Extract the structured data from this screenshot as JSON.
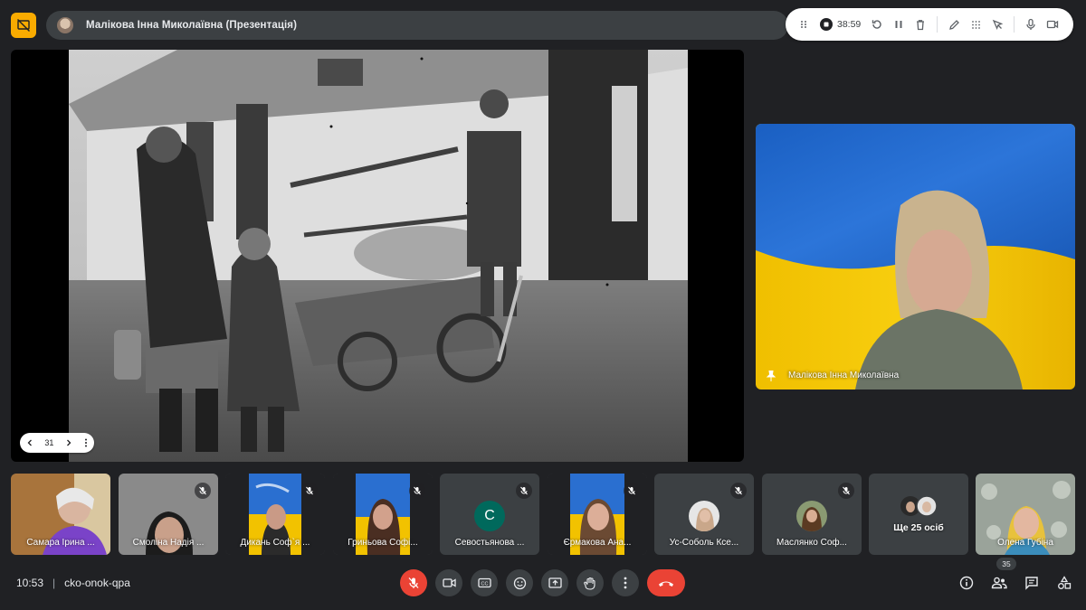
{
  "header": {
    "presenter_title": "Малікова Інна Миколаївна (Презентація)"
  },
  "recording_toolbar": {
    "timer": "38:59",
    "icons": [
      "drag-handle-icon",
      "record-stop-icon",
      "restart-icon",
      "pause-icon",
      "delete-icon",
      "pen-icon",
      "highlighter-icon",
      "pointer-icon",
      "mic-icon",
      "camera-icon"
    ]
  },
  "stage": {
    "slide_number": "31"
  },
  "speaker": {
    "name": "Малікова Інна Миколаївна"
  },
  "participants": [
    {
      "name": "Самара Ірина ...",
      "type": "video"
    },
    {
      "name": "Смоліна Надія ...",
      "type": "video"
    },
    {
      "name": "Дикань Соф`я ...",
      "type": "video"
    },
    {
      "name": "Гриньова Софі...",
      "type": "video"
    },
    {
      "name": "Севостьянова ...",
      "type": "letter",
      "initial": "С"
    },
    {
      "name": "Єрмакова Ана...",
      "type": "video"
    },
    {
      "name": "Ус-Соболь Ксе...",
      "type": "avatar"
    },
    {
      "name": "Маслянко Соф...",
      "type": "avatar"
    },
    {
      "name": "Ще 25 осіб",
      "type": "more"
    },
    {
      "name": "Олена Губіна",
      "type": "video"
    }
  ],
  "footer": {
    "time": "10:53",
    "meeting_code": "cko-onok-qpa",
    "people_count": "35"
  },
  "colors": {
    "background": "#202124",
    "tile": "#3c4043",
    "danger": "#ea4335",
    "present_accent": "#f9ab00",
    "flag_blue": "#1f66c8",
    "flag_yellow": "#f4c400"
  }
}
